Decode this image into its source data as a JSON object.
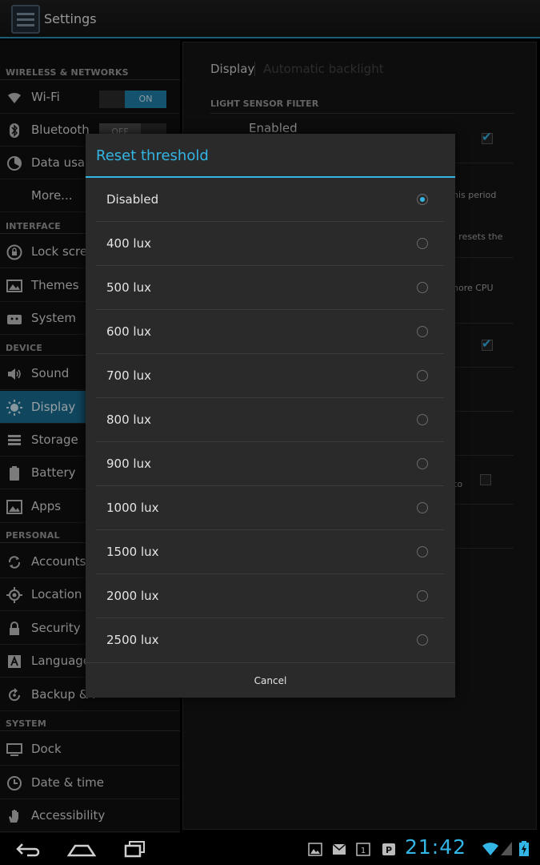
{
  "app": {
    "title": "Settings"
  },
  "sidebar": {
    "sections": {
      "wireless": "WIRELESS & NETWORKS",
      "interface": "INTERFACE",
      "device": "DEVICE",
      "personal": "PERSONAL",
      "system": "SYSTEM"
    },
    "items": {
      "wifi": "Wi-Fi",
      "wifi_toggle": "ON",
      "bluetooth": "Bluetooth",
      "bluetooth_toggle": "OFF",
      "data_usage": "Data usag",
      "more": "More...",
      "lock_screen": "Lock scree",
      "themes": "Themes",
      "system": "System",
      "sound": "Sound",
      "display": "Display",
      "storage": "Storage",
      "battery": "Battery",
      "apps": "Apps",
      "accounts": "Accounts",
      "location": "Location s",
      "security": "Security",
      "language": "Language",
      "backup": "Backup & r",
      "dock": "Dock",
      "date_time": "Date & time",
      "accessibility": "Accessibility"
    }
  },
  "content": {
    "breadcrumb": "Display",
    "breadcrumb_sub": "Automatic backlight",
    "section_header": "LIGHT SENSOR FILTER",
    "enabled_title": "Enabled",
    "frag_period": "his period",
    "frag_resets": "e resets the",
    "frag_cpu": "nore CPU",
    "frag_to": "to"
  },
  "dialog": {
    "title": "Reset threshold",
    "options": [
      "Disabled",
      "400 lux",
      "500 lux",
      "600 lux",
      "700 lux",
      "800 lux",
      "900 lux",
      "1000 lux",
      "1500 lux",
      "2000 lux",
      "2500 lux"
    ],
    "selected_index": 0,
    "cancel_label": "Cancel"
  },
  "statusbar": {
    "clock": "21:42"
  },
  "colors": {
    "accent": "#33b5e5",
    "selected_bg": "#1a6e93"
  }
}
